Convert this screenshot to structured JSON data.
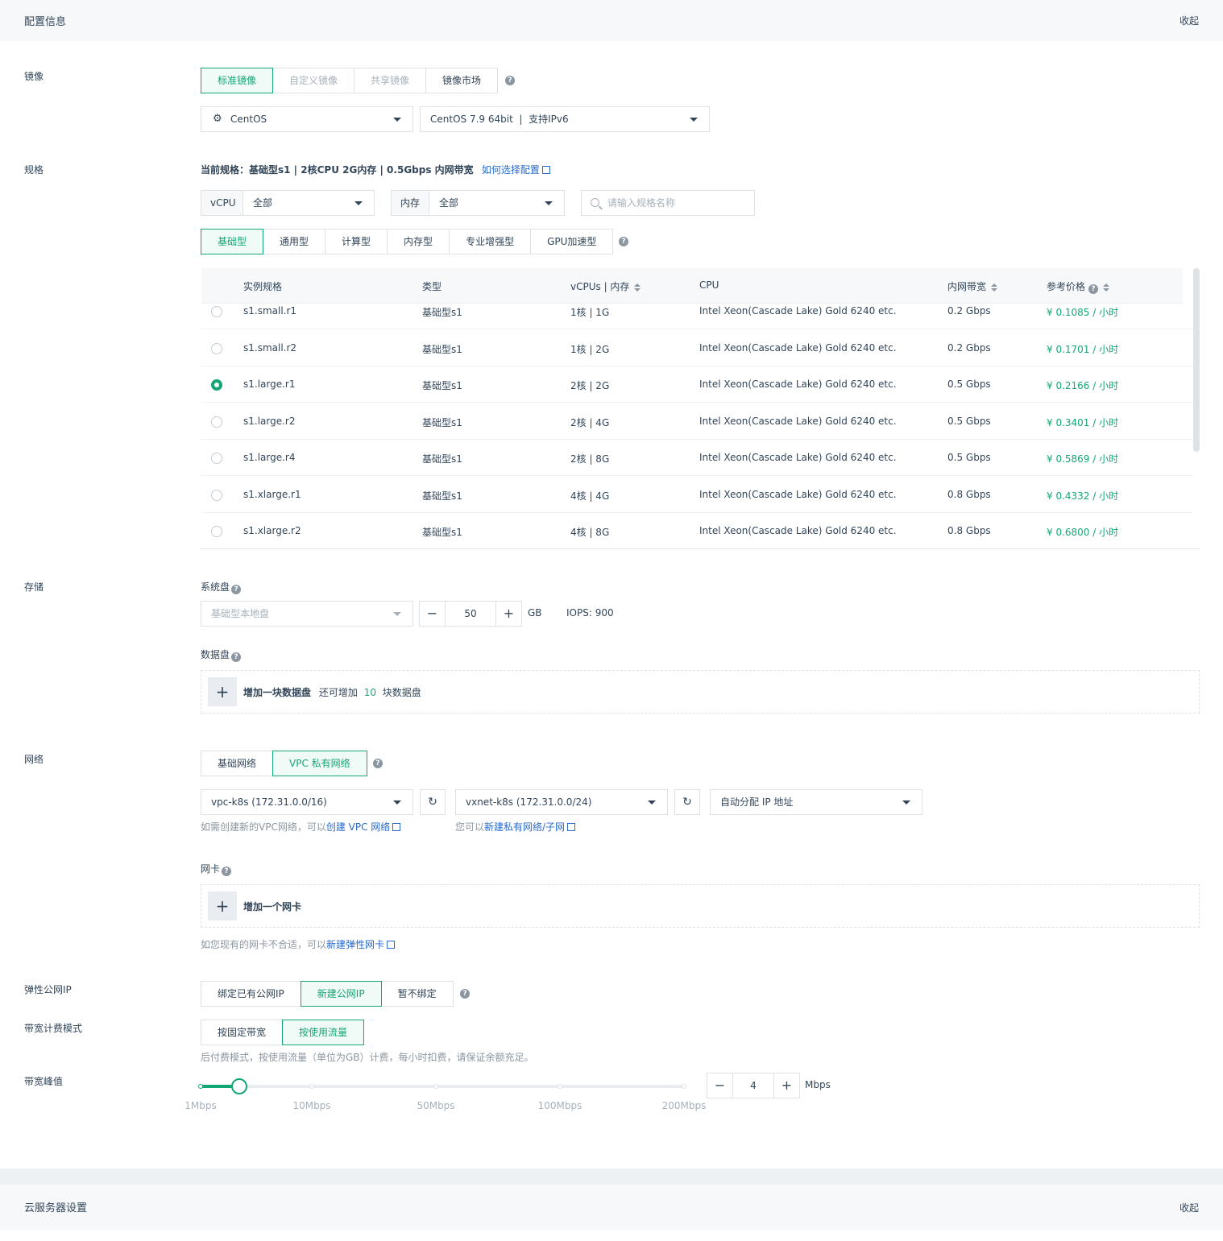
{
  "config": {
    "title": "配置信息",
    "collapse": "收起"
  },
  "image": {
    "label": "镜像",
    "tabs": [
      "标准镜像",
      "自定义镜像",
      "共享镜像",
      "镜像市场"
    ],
    "os": "CentOS",
    "version": "CentOS 7.9 64bit  |  支持IPv6"
  },
  "spec": {
    "label": "规格",
    "current_label": "当前规格：",
    "current_value": "基础型s1 | 2核CPU 2G内存 | 0.5Gbps 内网带宽",
    "how_link": "如何选择配置",
    "vcpu_addon": "vCPU",
    "vcpu_value": "全部",
    "mem_addon": "内存",
    "mem_value": "全部",
    "search_placeholder": "请输入规格名称",
    "types": [
      "基础型",
      "通用型",
      "计算型",
      "内存型",
      "专业增强型",
      "GPU加速型"
    ],
    "columns": [
      "实例规格",
      "类型",
      "vCPUs | 内存",
      "CPU",
      "内网带宽",
      "参考价格"
    ],
    "rows": [
      {
        "name": "s1.small.r1",
        "type": "基础型s1",
        "vcpu": "1核 | 1G",
        "cpu": "Intel Xeon(Cascade Lake) Gold 6240 etc.",
        "bw": "0.2 Gbps",
        "price": "¥ 0.1085 / 小时"
      },
      {
        "name": "s1.small.r2",
        "type": "基础型s1",
        "vcpu": "1核 | 2G",
        "cpu": "Intel Xeon(Cascade Lake) Gold 6240 etc.",
        "bw": "0.2 Gbps",
        "price": "¥ 0.1701 / 小时"
      },
      {
        "name": "s1.large.r1",
        "type": "基础型s1",
        "vcpu": "2核 | 2G",
        "cpu": "Intel Xeon(Cascade Lake) Gold 6240 etc.",
        "bw": "0.5 Gbps",
        "price": "¥ 0.2166 / 小时"
      },
      {
        "name": "s1.large.r2",
        "type": "基础型s1",
        "vcpu": "2核 | 4G",
        "cpu": "Intel Xeon(Cascade Lake) Gold 6240 etc.",
        "bw": "0.5 Gbps",
        "price": "¥ 0.3401 / 小时"
      },
      {
        "name": "s1.large.r4",
        "type": "基础型s1",
        "vcpu": "2核 | 8G",
        "cpu": "Intel Xeon(Cascade Lake) Gold 6240 etc.",
        "bw": "0.5 Gbps",
        "price": "¥ 0.5869 / 小时"
      },
      {
        "name": "s1.xlarge.r1",
        "type": "基础型s1",
        "vcpu": "4核 | 4G",
        "cpu": "Intel Xeon(Cascade Lake) Gold 6240 etc.",
        "bw": "0.8 Gbps",
        "price": "¥ 0.4332 / 小时"
      },
      {
        "name": "s1.xlarge.r2",
        "type": "基础型s1",
        "vcpu": "4核 | 8G",
        "cpu": "Intel Xeon(Cascade Lake) Gold 6240 etc.",
        "bw": "0.8 Gbps",
        "price": "¥ 0.6800 / 小时"
      }
    ]
  },
  "storage": {
    "label": "存储",
    "sys_label": "系统盘",
    "sys_type": "基础型本地盘",
    "sys_size": "50",
    "unit": "GB",
    "iops": "IOPS: 900",
    "data_label": "数据盘",
    "add_disk": "增加一块数据盘",
    "add_disk_pre": "还可增加",
    "add_disk_count": "10",
    "add_disk_post": "块数据盘"
  },
  "network": {
    "label": "网络",
    "tabs": [
      "基础网络",
      "VPC 私有网络"
    ],
    "vpc": "vpc-k8s (172.31.0.0/16)",
    "vxnet": "vxnet-k8s (172.31.0.0/24)",
    "ip": "自动分配 IP 地址",
    "vpc_hint": "如需创建新的VPC网络，可以",
    "vpc_link": "创建 VPC 网络",
    "vxnet_hint": "您可以",
    "vxnet_link": "新建私有网络/子网",
    "nic_label": "网卡",
    "add_nic": "增加一个网卡",
    "nic_hint": "如您现有的网卡不合适，可以",
    "nic_link": "新建弹性网卡"
  },
  "eip": {
    "label": "弹性公网IP",
    "tabs": [
      "绑定已有公网IP",
      "新建公网IP",
      "暂不绑定"
    ]
  },
  "billing": {
    "label": "带宽计费模式",
    "tabs": [
      "按固定带宽",
      "按使用流量"
    ],
    "hint": "后付费模式，按使用流量（单位为GB）计费，每小时扣费，请保证余额充足。"
  },
  "bandwidth": {
    "label": "带宽峰值",
    "ticks": [
      "1Mbps",
      "10Mbps",
      "50Mbps",
      "100Mbps",
      "200Mbps"
    ],
    "value": "4",
    "unit": "Mbps"
  },
  "server": {
    "title": "云服务器设置",
    "collapse": "收起"
  }
}
